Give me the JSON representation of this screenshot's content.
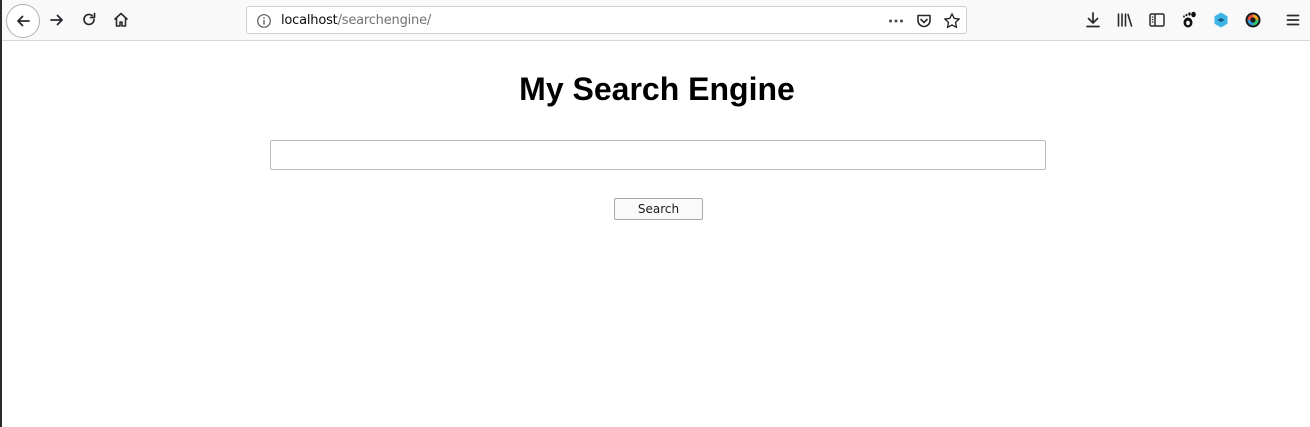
{
  "browser": {
    "url_host": "localhost",
    "url_path": "/searchengine/",
    "icons": {
      "back": "back-arrow-icon",
      "forward": "forward-arrow-icon",
      "reload": "reload-icon",
      "home": "home-icon",
      "site_info": "info-icon",
      "page_actions": "more-dots-icon",
      "pocket": "pocket-icon",
      "bookmark": "star-icon",
      "downloads": "download-icon",
      "library": "library-icon",
      "sidebar": "sidebar-icon",
      "extension_1": "gnome-foot-icon",
      "extension_2": "cube-extension-icon",
      "extension_3": "color-wheel-icon",
      "menu": "hamburger-menu-icon"
    }
  },
  "page": {
    "title": "My Search Engine",
    "search_input_value": "",
    "search_input_placeholder": "",
    "search_button_label": "Search"
  }
}
